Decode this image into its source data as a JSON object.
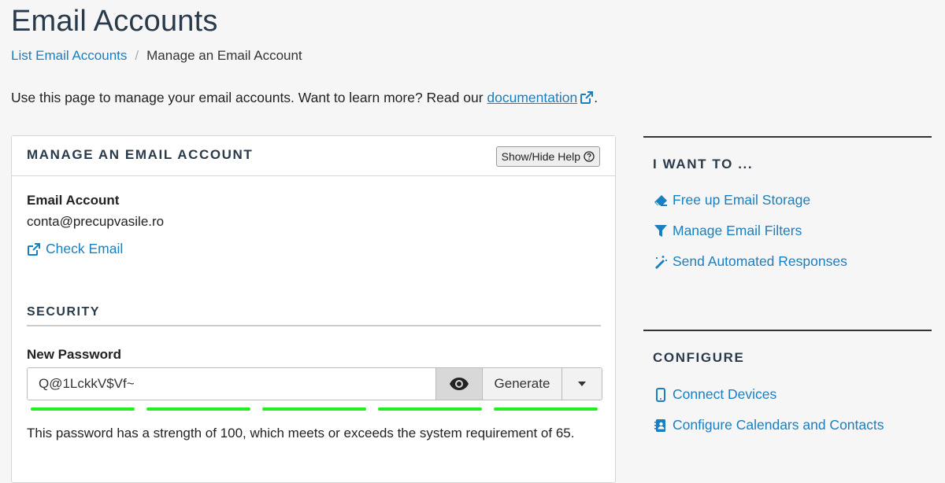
{
  "page": {
    "title": "Email Accounts",
    "breadcrumb": {
      "parent": "List Email Accounts",
      "separator": "/",
      "current": "Manage an Email Account"
    },
    "intro": {
      "text": "Use this page to manage your email accounts. Want to learn more? Read our ",
      "link": "documentation",
      "suffix": "."
    }
  },
  "panel": {
    "title": "MANAGE AN EMAIL ACCOUNT",
    "help_button": "Show/Hide Help",
    "account_label": "Email Account",
    "account_value": "conta@precupvasile.ro",
    "check_email": "Check Email",
    "security_title": "SECURITY",
    "password_label": "New Password",
    "password_value": "Q@1LckkV$Vf~",
    "generate_label": "Generate",
    "strength_score": 100,
    "strength_required": 65,
    "strength_text": "This password has a strength of 100, which meets or exceeds the system requirement of 65.",
    "strength_color": "#22ee22"
  },
  "sidebar": {
    "want_to": {
      "title": "I WANT TO ...",
      "items": [
        {
          "label": "Free up Email Storage",
          "icon": "eraser-icon"
        },
        {
          "label": "Manage Email Filters",
          "icon": "filter-icon"
        },
        {
          "label": "Send Automated Responses",
          "icon": "magic-wand-icon"
        }
      ]
    },
    "configure": {
      "title": "CONFIGURE",
      "items": [
        {
          "label": "Connect Devices",
          "icon": "mobile-icon"
        },
        {
          "label": "Configure Calendars and Contacts",
          "icon": "address-book-icon"
        }
      ]
    }
  },
  "colors": {
    "link": "#1a7fc1",
    "heading": "#293a4a",
    "strength_bar": "#22ee22"
  }
}
